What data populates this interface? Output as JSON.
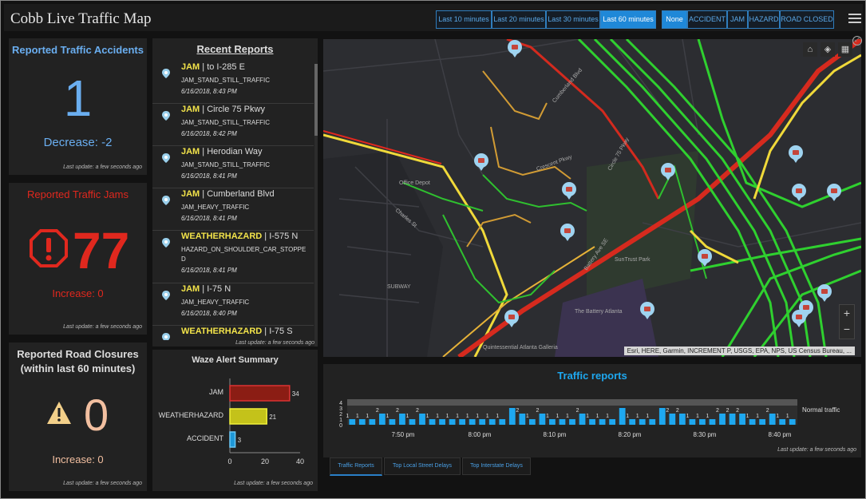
{
  "header": {
    "title": "Cobb Live Traffic Map",
    "time_filters": [
      "Last 10 minutes",
      "Last 20 minutes",
      "Last 30 minutes",
      "Last 60 minutes"
    ],
    "type_filters": [
      "None",
      "ACCIDENT",
      "JAM",
      "HAZARD",
      "ROAD CLOSED"
    ]
  },
  "accidents": {
    "title": "Reported Traffic Accidents",
    "value": "1",
    "change": "Decrease: -2",
    "last_update": "Last update: a few seconds ago"
  },
  "jams": {
    "title": "Reported Traffic Jams",
    "value": "77",
    "change": "Increase: 0",
    "last_update": "Last update: a few seconds ago"
  },
  "closures": {
    "title_line1": "Reported Road Closures",
    "title_line2": "(within last 60 minutes)",
    "value": "0",
    "change": "Increase: 0",
    "last_update": "Last update: a few seconds ago"
  },
  "reports": {
    "title": "Recent Reports",
    "items": [
      {
        "type": "JAM",
        "location": " | to I-285 E",
        "subtype": "JAM_STAND_STILL_TRAFFIC",
        "time": "6/16/2018, 8:43 PM"
      },
      {
        "type": "JAM",
        "location": " | Circle 75 Pkwy",
        "subtype": "JAM_STAND_STILL_TRAFFIC",
        "time": "6/16/2018, 8:42 PM"
      },
      {
        "type": "JAM",
        "location": " | Herodian Way",
        "subtype": "JAM_STAND_STILL_TRAFFIC",
        "time": "6/16/2018, 8:41 PM"
      },
      {
        "type": "JAM",
        "location": " | Cumberland Blvd",
        "subtype": "JAM_HEAVY_TRAFFIC",
        "time": "6/16/2018, 8:41 PM"
      },
      {
        "type": "WEATHERHAZARD",
        "location": " | I-575 N",
        "subtype": "HAZARD_ON_SHOULDER_CAR_STOPPED",
        "time": "6/16/2018, 8:41 PM"
      },
      {
        "type": "JAM",
        "location": " | I-75 N",
        "subtype": "JAM_HEAVY_TRAFFIC",
        "time": "6/16/2018, 8:40 PM"
      },
      {
        "type": "WEATHERHAZARD",
        "location": " | I-75 S",
        "subtype": "",
        "time": ""
      }
    ],
    "last_update": "Last update: a few seconds ago"
  },
  "waze_summary": {
    "title": "Waze Alert Summary",
    "last_update": "Last update: a few seconds ago"
  },
  "map": {
    "attribution": "Esri, HERE, Garmin, INCREMENT P, USGS, EPA, NPS, US Census Bureau, ...",
    "labels": [
      "Office Depot",
      "Charles St",
      "Crescent Pkwy",
      "SunTrust Park",
      "The Battery Atlanta",
      "Battery Ave SE",
      "Circle 75 Pkwy",
      "Cumberland Blvd",
      "SUBWAY",
      "Quintessential Atlanta Galleria"
    ],
    "zoom_in": "+",
    "zoom_out": "−"
  },
  "traffic_reports": {
    "title": "Traffic reports",
    "legend": "Normal traffic",
    "last_update": "Last update: a few seconds ago"
  },
  "tabs": [
    "Traffic Reports",
    "Top Local Street Delays",
    "Top Interstate Delays"
  ],
  "colors": {
    "accent": "#6aaef0",
    "jam_red": "#e0281e",
    "closure_orange": "#f2bfa0",
    "bar_blue": "#1ea8f0"
  },
  "chart_data": [
    {
      "type": "bar",
      "orientation": "horizontal",
      "title": "Waze Alert Summary",
      "categories": [
        "JAM",
        "WEATHERHAZARD",
        "ACCIDENT"
      ],
      "values": [
        34,
        21,
        3
      ],
      "colors": [
        "#8b1d14",
        "#c4c21a",
        "#1e98d8"
      ],
      "xlim": [
        0,
        40
      ],
      "xticks": [
        0,
        20,
        40
      ]
    },
    {
      "type": "bar",
      "title": "Traffic reports",
      "y_ticks": [
        0,
        1,
        2,
        3,
        4
      ],
      "x_tick_labels": [
        "7:50 pm",
        "8:00 pm",
        "8:10 pm",
        "8:20 pm",
        "8:30 pm",
        "8:40 pm"
      ],
      "values": [
        1,
        1,
        1,
        2,
        1,
        2,
        1,
        2,
        1,
        1,
        1,
        1,
        1,
        1,
        1,
        1,
        3,
        2,
        1,
        2,
        1,
        1,
        1,
        2,
        1,
        1,
        1,
        3,
        1,
        1,
        1,
        3,
        2,
        2,
        1,
        1,
        1,
        2,
        2,
        2,
        1,
        1,
        2,
        1,
        1
      ],
      "value_labels": [
        "1",
        "1",
        "1",
        "2",
        "1",
        "2",
        "1",
        "2",
        "1",
        "1",
        "1",
        "1",
        "1",
        "1",
        "1",
        "1",
        "",
        "2",
        "1",
        "2",
        "1",
        "1",
        "1",
        "2",
        "1",
        "1",
        "1",
        "",
        "1",
        "1",
        "1",
        "",
        "2",
        "2",
        "1",
        "1",
        "1",
        "2",
        "2",
        "2",
        "1",
        "1",
        "2",
        "1",
        "1"
      ],
      "legend": "Normal traffic"
    }
  ]
}
